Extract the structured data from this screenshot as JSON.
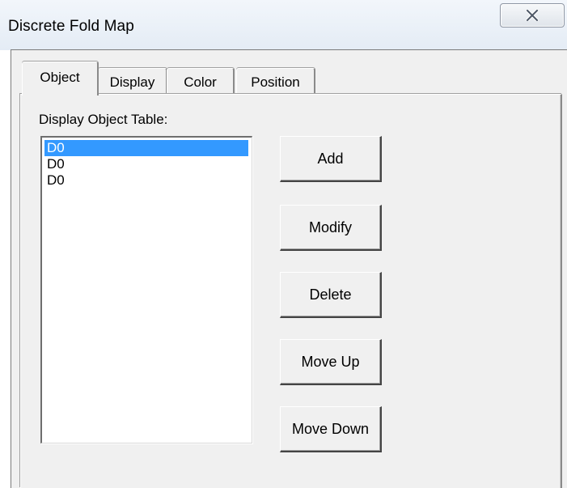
{
  "window": {
    "title": "Discrete Fold Map"
  },
  "tabs": [
    {
      "label": "Object",
      "active": true
    },
    {
      "label": "Display",
      "active": false
    },
    {
      "label": "Color",
      "active": false
    },
    {
      "label": "Position",
      "active": false
    }
  ],
  "object_tab": {
    "table_label": "Display Object Table:",
    "items": [
      {
        "label": "D0",
        "selected": true
      },
      {
        "label": "D0",
        "selected": false
      },
      {
        "label": "D0",
        "selected": false
      }
    ],
    "buttons": {
      "add": "Add",
      "modify": "Modify",
      "delete": "Delete",
      "move_up": "Move Up",
      "move_down": "Move Down"
    }
  },
  "colors": {
    "selection": "#3399ff",
    "face": "#f0f0f0"
  },
  "icons": {
    "close": "close-x-icon"
  }
}
